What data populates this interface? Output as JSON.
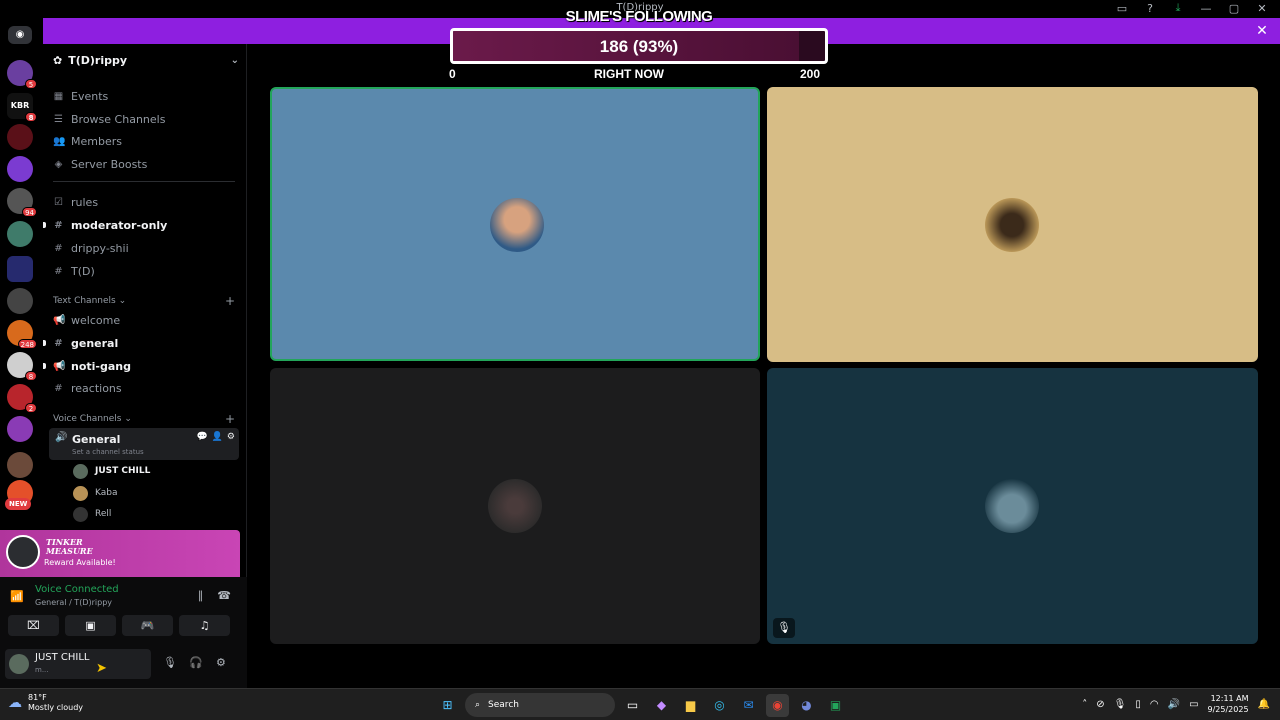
{
  "window": {
    "title": "T(D)rippy"
  },
  "overlay": {
    "title": "SLIME'S FOLLOWING",
    "progress_text": "186 (93%)",
    "progress_fraction": 0.93,
    "min_label": "0",
    "center_label": "RIGHT NOW",
    "max_label": "200",
    "bar_color": "#8e1fe0"
  },
  "rail": {
    "badges": [
      "5",
      "8",
      "",
      "",
      "94",
      "",
      "",
      "",
      "248",
      "8",
      "2"
    ],
    "new_label": "NEW"
  },
  "server": {
    "name": "T(D)rippy"
  },
  "nav": {
    "events": "Events",
    "browse": "Browse Channels",
    "members": "Members",
    "boosts": "Server Boosts"
  },
  "channels": {
    "top": [
      {
        "name": "rules",
        "icon": "rules-icon",
        "bold": false
      },
      {
        "name": "moderator-only",
        "icon": "hash-icon",
        "bold": true
      },
      {
        "name": "drippy-shii",
        "icon": "hash-icon",
        "bold": false
      },
      {
        "name": "T(D)",
        "icon": "hash-icon",
        "bold": false
      }
    ],
    "text_category": "Text Channels",
    "text": [
      {
        "name": "welcome",
        "icon": "announcement-icon",
        "bold": false
      },
      {
        "name": "general",
        "icon": "hash-icon",
        "bold": true
      },
      {
        "name": "noti-gang",
        "icon": "announcement-icon",
        "bold": true
      },
      {
        "name": "reactions",
        "icon": "hash-icon",
        "bold": false
      }
    ],
    "voice_category": "Voice Channels",
    "voice_channel": {
      "name": "General",
      "status_placeholder": "Set a channel status"
    },
    "voice_users": [
      "JUST CHILL",
      "Kaba",
      "Rell"
    ]
  },
  "reward": {
    "logo_line1": "TINKER",
    "logo_line2": "MEASURE",
    "text": "Reward Available!"
  },
  "voice_connected": {
    "title": "Voice Connected",
    "subtitle": "General / T(D)rippy"
  },
  "user": {
    "name": "JUST CHILL",
    "status": "m..."
  },
  "taskbar": {
    "temp": "81°F",
    "weather": "Mostly cloudy",
    "search_placeholder": "Search",
    "time": "12:11 AM",
    "date": "9/25/2025"
  },
  "colors": {
    "tile1": "#5b89ad",
    "tile2": "#d7bd86",
    "tile3": "#1c1c1d",
    "tile4": "#163340",
    "speaking": "#23a55a"
  }
}
